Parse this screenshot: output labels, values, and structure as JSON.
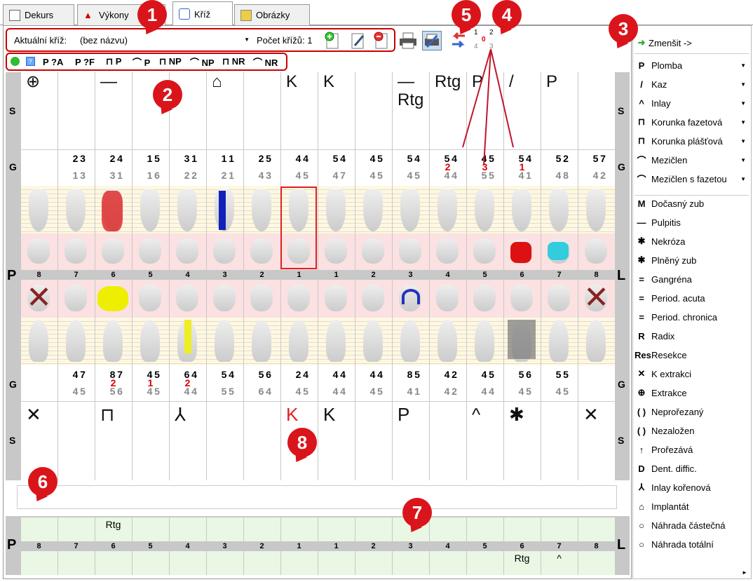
{
  "tabs": [
    {
      "label": "Dekurs"
    },
    {
      "label": "Výkony"
    },
    {
      "label": "Kříž"
    },
    {
      "label": "Obrázky"
    }
  ],
  "toolbar": {
    "cross_label": "Aktuální kříž:",
    "cross_value": "(bez názvu)",
    "count_label": "Počet křížů: 1"
  },
  "pager": {
    "top_left": "1",
    "top_right": "2",
    "center": "0",
    "bottom_left": "4",
    "bottom_right": "3"
  },
  "symbol_buttons": [
    "P ?A",
    "P ?F",
    "⊓ P",
    "⌒ P",
    "⊓ NP",
    "⌒ NP",
    "⊓ NR",
    "⌒ NR"
  ],
  "callouts": [
    "1",
    "2",
    "3",
    "4",
    "5",
    "6",
    "7",
    "8"
  ],
  "side_labels": {
    "s": "S",
    "g": "G",
    "p": "P",
    "l": "L"
  },
  "upper_symbols": [
    "⊕",
    "",
    "—",
    "",
    "",
    "⌂",
    "",
    "K",
    "K",
    "",
    "— Rtg",
    "Rtg",
    "P",
    "/",
    "P",
    ""
  ],
  "upper_nums_top": [
    [
      "",
      ""
    ],
    [
      "2",
      "3"
    ],
    [
      "2",
      "4"
    ],
    [
      "1",
      "5"
    ],
    [
      "3",
      "1"
    ],
    [
      "1",
      "1"
    ],
    [
      "2",
      "5"
    ],
    [
      "4",
      "4"
    ],
    [
      "5",
      "4"
    ],
    [
      "4",
      "5"
    ],
    [
      "5",
      "4"
    ],
    [
      "5",
      "4"
    ],
    [
      "4",
      "5"
    ],
    [
      "5",
      "4"
    ],
    [
      "5",
      "2"
    ],
    [
      "5",
      "7"
    ]
  ],
  "upper_nums_bottom": [
    [
      "",
      ""
    ],
    [
      "1",
      "3"
    ],
    [
      "3",
      "1"
    ],
    [
      "1",
      "6"
    ],
    [
      "2",
      "2"
    ],
    [
      "2",
      "1"
    ],
    [
      "4",
      "3"
    ],
    [
      "4",
      "5"
    ],
    [
      "4",
      "7"
    ],
    [
      "4",
      "5"
    ],
    [
      "4",
      "5"
    ],
    [
      "4",
      "4"
    ],
    [
      "5",
      "5"
    ],
    [
      "4",
      "1"
    ],
    [
      "4",
      "8"
    ],
    [
      "4",
      "2"
    ]
  ],
  "upper_red": [
    "",
    "",
    "",
    "",
    "",
    "",
    "",
    "",
    "",
    "",
    "",
    "2",
    "3",
    "1",
    "",
    ""
  ],
  "tooth_numbers": [
    "8",
    "7",
    "6",
    "5",
    "4",
    "3",
    "2",
    "1",
    "1",
    "2",
    "3",
    "4",
    "5",
    "6",
    "7",
    "8"
  ],
  "lower_nums_top": [
    [
      "",
      ""
    ],
    [
      "4",
      "7"
    ],
    [
      "8",
      "7"
    ],
    [
      "4",
      "5"
    ],
    [
      "6",
      "4"
    ],
    [
      "5",
      "4"
    ],
    [
      "5",
      "6"
    ],
    [
      "2",
      "4"
    ],
    [
      "4",
      "4"
    ],
    [
      "4",
      "4"
    ],
    [
      "8",
      "5"
    ],
    [
      "4",
      "2"
    ],
    [
      "4",
      "5"
    ],
    [
      "5",
      "6"
    ],
    [
      "5",
      "5"
    ],
    [
      "",
      ""
    ]
  ],
  "lower_nums_bottom": [
    [
      "",
      ""
    ],
    [
      "4",
      "5"
    ],
    [
      "5",
      "6"
    ],
    [
      "4",
      "5"
    ],
    [
      "4",
      "4"
    ],
    [
      "5",
      "5"
    ],
    [
      "6",
      "4"
    ],
    [
      "4",
      "5"
    ],
    [
      "4",
      "4"
    ],
    [
      "4",
      "5"
    ],
    [
      "4",
      "1"
    ],
    [
      "4",
      "2"
    ],
    [
      "4",
      "4"
    ],
    [
      "4",
      "5"
    ],
    [
      "4",
      "5"
    ],
    [
      "",
      ""
    ]
  ],
  "lower_red": [
    "",
    "",
    "2",
    "1",
    "2",
    "",
    "",
    "",
    "",
    "",
    "",
    "",
    "",
    "",
    "",
    ""
  ],
  "lower_symbols": [
    "✕",
    "",
    "⊓",
    "",
    "⅄",
    "",
    "",
    "K",
    "K",
    "",
    "P",
    "",
    "^",
    "✱",
    "",
    "✕"
  ],
  "bottom_upper": [
    "",
    "",
    "Rtg",
    "",
    "",
    "",
    "",
    "",
    "",
    "",
    "",
    "",
    "",
    "",
    "",
    ""
  ],
  "bottom_lower": [
    "",
    "",
    "",
    "",
    "",
    "",
    "",
    "",
    "",
    "",
    "",
    "",
    "",
    "Rtg",
    "^",
    ""
  ],
  "sidebar": {
    "shrink": "Zmenšit ->",
    "items": [
      {
        "sym": "P",
        "label": "Plomba",
        "arrow": true
      },
      {
        "sym": "/",
        "label": "Kaz",
        "arrow": true
      },
      {
        "sym": "^",
        "label": "Inlay",
        "arrow": true
      },
      {
        "sym": "⊓",
        "label": "Korunka fazetová",
        "arrow": true
      },
      {
        "sym": "⊓",
        "label": "Korunka plášťová",
        "arrow": true
      },
      {
        "sym": "⌒",
        "label": "Mezičlen",
        "arrow": true
      },
      {
        "sym": "⌒",
        "label": "Mezičlen s fazetou",
        "arrow": true
      },
      {
        "sym": "M",
        "label": "Dočasný zub"
      },
      {
        "sym": "—",
        "label": "Pulpitis"
      },
      {
        "sym": "✱",
        "label": "Nekróza"
      },
      {
        "sym": "✱",
        "label": "Plněný zub"
      },
      {
        "sym": "=",
        "label": "Gangréna"
      },
      {
        "sym": "=",
        "label": "Period. acuta"
      },
      {
        "sym": "=",
        "label": "Period. chronica"
      },
      {
        "sym": "R",
        "label": "Radix"
      },
      {
        "sym": "Res",
        "label": "Resekce"
      },
      {
        "sym": "✕",
        "label": "K extrakci"
      },
      {
        "sym": "⊕",
        "label": "Extrakce"
      },
      {
        "sym": "( )",
        "label": "Neprořezaný"
      },
      {
        "sym": "( )",
        "label": "Nezaložen"
      },
      {
        "sym": "↑",
        "label": "Prořezává"
      },
      {
        "sym": "D",
        "label": "Dent. diffic."
      },
      {
        "sym": "⅄",
        "label": "Inlay kořenová"
      },
      {
        "sym": "⌂",
        "label": "Implantát"
      },
      {
        "sym": "○",
        "label": "Náhrada částečná"
      },
      {
        "sym": "○",
        "label": "Náhrada totální"
      }
    ]
  },
  "colors": {
    "accent_red": "#d9151b",
    "pink_band": "#fbe1e1",
    "beige_band": "#fdf8e4",
    "green_band": "#e9f7e4"
  }
}
